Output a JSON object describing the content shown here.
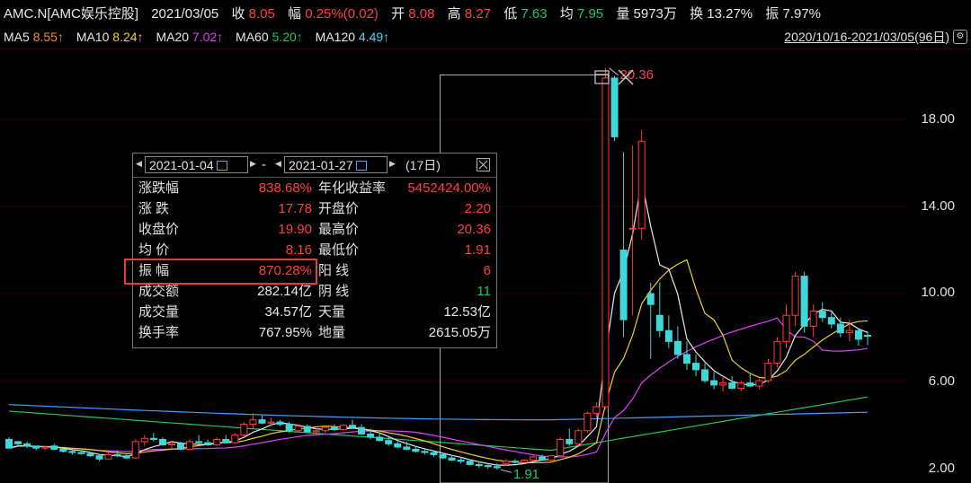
{
  "header": {
    "symbol": "AMC.N[AMC娱乐控股]",
    "date": "2021/03/05",
    "close_label": "收",
    "close_value": "8.05",
    "change_label": "幅",
    "change_value": "0.25%(0.02)",
    "open_label": "开",
    "open_value": "8.08",
    "high_label": "高",
    "high_value": "8.27",
    "low_label": "低",
    "low_value": "7.63",
    "avg_label": "均",
    "avg_value": "7.95",
    "volume_label": "量",
    "volume_value": "5973万",
    "turnover_label": "换",
    "turnover_value": "13.27%",
    "amplitude_label": "振",
    "amplitude_value": "7.97%"
  },
  "ma_bar": {
    "ma5_label": "MA5",
    "ma5_value": "8.55↑",
    "ma10_label": "MA10",
    "ma10_value": "8.24↑",
    "ma20_label": "MA20",
    "ma20_value": "7.02↑",
    "ma60_label": "MA60",
    "ma60_value": "5.20↑",
    "ma120_label": "MA120",
    "ma120_value": "4.49↑",
    "range_text": "2020/10/16-2021/03/05(96日)"
  },
  "colors": {
    "up": "#ff3b3b",
    "down": "#3fd7d7",
    "ma5": "#e8e8e8",
    "ma10": "#f0d020",
    "ma20": "#e040fb",
    "ma60": "#22c55e",
    "ma120": "#40a0ff"
  },
  "popup": {
    "start_date": "2021-01-04",
    "dash": "-",
    "end_date": "2021-01-27",
    "days": "(17日)",
    "rows": [
      {
        "k1": "涨跌幅",
        "v1": "838.68%",
        "k2": "年化收益率",
        "v2": "5452424.00%"
      },
      {
        "k1": "涨 跌",
        "v1": "17.78",
        "k2": "开盘价",
        "v2": "2.20"
      },
      {
        "k1": "收盘价",
        "v1": "19.90",
        "k2": "最高价",
        "v2": "20.36"
      },
      {
        "k1": "均 价",
        "v1": "8.16",
        "k2": "最低价",
        "v2": "1.91"
      },
      {
        "k1": "振 幅",
        "v1": "870.28%",
        "k2": "阳 线",
        "v2": "6"
      },
      {
        "k1": "成交额",
        "v1": "282.14亿",
        "k2": "阴 线",
        "v2": "11"
      },
      {
        "k1": "成交量",
        "v1": "34.57亿",
        "k2": "天量",
        "v2": "12.53亿"
      },
      {
        "k1": "换手率",
        "v1": "767.95%",
        "k2": "地量",
        "v2": "2615.05万"
      }
    ]
  },
  "chart_data": {
    "type": "candlestick",
    "y_ticks": [
      "18.00",
      "14.00",
      "10.00",
      "6.00",
      "2.00"
    ],
    "ylim": [
      1.6,
      20.6
    ],
    "high_marker": "20.36",
    "low_marker": "1.91",
    "candles": [
      [
        3.3,
        3.4,
        3.0,
        2.9
      ],
      [
        3.2,
        3.2,
        3.0,
        3.1
      ],
      [
        3.1,
        3.2,
        2.9,
        3.0
      ],
      [
        3.0,
        3.0,
        2.8,
        2.9
      ],
      [
        2.9,
        3.0,
        2.8,
        2.95
      ],
      [
        3.0,
        3.1,
        2.8,
        2.85
      ],
      [
        2.85,
        2.9,
        2.7,
        2.75
      ],
      [
        2.75,
        2.8,
        2.6,
        2.7
      ],
      [
        2.7,
        2.8,
        2.6,
        2.65
      ],
      [
        2.65,
        2.7,
        2.5,
        2.55
      ],
      [
        2.55,
        2.6,
        2.3,
        2.4
      ],
      [
        2.4,
        2.7,
        2.4,
        2.6
      ],
      [
        2.6,
        2.8,
        2.5,
        2.55
      ],
      [
        2.55,
        2.6,
        2.4,
        2.45
      ],
      [
        2.45,
        3.3,
        2.4,
        3.2
      ],
      [
        3.2,
        3.5,
        3.0,
        3.35
      ],
      [
        3.35,
        3.6,
        3.2,
        3.3
      ],
      [
        3.3,
        3.4,
        3.0,
        3.05
      ],
      [
        3.05,
        3.2,
        2.9,
        3.1
      ],
      [
        3.1,
        3.2,
        2.8,
        2.85
      ],
      [
        2.85,
        3.3,
        2.8,
        3.2
      ],
      [
        3.2,
        3.5,
        3.1,
        3.15
      ],
      [
        3.15,
        3.3,
        3.0,
        3.05
      ],
      [
        3.05,
        3.4,
        3.0,
        3.3
      ],
      [
        3.3,
        3.5,
        3.1,
        3.15
      ],
      [
        3.15,
        3.6,
        3.1,
        3.5
      ],
      [
        3.5,
        4.1,
        3.4,
        4.0
      ],
      [
        4.0,
        4.5,
        3.8,
        4.2
      ],
      [
        4.2,
        4.4,
        4.0,
        4.05
      ],
      [
        4.05,
        4.3,
        3.9,
        4.1
      ],
      [
        4.1,
        4.2,
        3.9,
        4.0
      ],
      [
        4.0,
        4.1,
        3.6,
        3.7
      ],
      [
        3.7,
        4.0,
        3.6,
        3.9
      ],
      [
        3.9,
        4.0,
        3.6,
        3.65
      ],
      [
        3.65,
        3.8,
        3.5,
        3.7
      ],
      [
        3.7,
        3.9,
        3.6,
        3.85
      ],
      [
        3.85,
        4.0,
        3.7,
        3.75
      ],
      [
        3.75,
        4.0,
        3.7,
        3.95
      ],
      [
        3.95,
        4.2,
        3.8,
        3.85
      ],
      [
        3.85,
        4.0,
        3.5,
        3.55
      ],
      [
        3.55,
        3.8,
        3.3,
        3.4
      ],
      [
        3.4,
        3.6,
        3.2,
        3.25
      ],
      [
        3.25,
        3.4,
        3.0,
        3.1
      ],
      [
        3.1,
        3.2,
        2.9,
        2.95
      ],
      [
        2.95,
        3.2,
        2.8,
        2.85
      ],
      [
        2.85,
        3.0,
        2.7,
        2.75
      ],
      [
        2.75,
        2.9,
        2.6,
        2.7
      ],
      [
        2.7,
        2.8,
        2.5,
        2.6
      ],
      [
        2.6,
        2.7,
        2.4,
        2.45
      ],
      [
        2.45,
        2.6,
        2.3,
        2.35
      ],
      [
        2.35,
        2.5,
        2.2,
        2.3
      ],
      [
        2.3,
        2.4,
        2.1,
        2.15
      ],
      [
        2.15,
        2.3,
        2.0,
        2.1
      ],
      [
        2.1,
        2.2,
        1.95,
        2.05
      ],
      [
        2.05,
        2.2,
        1.91,
        2.0
      ],
      [
        2.2,
        2.4,
        2.1,
        2.3
      ],
      [
        2.3,
        2.4,
        2.2,
        2.25
      ],
      [
        2.25,
        2.4,
        2.2,
        2.35
      ],
      [
        2.35,
        2.6,
        2.3,
        2.5
      ],
      [
        2.5,
        2.6,
        2.3,
        2.35
      ],
      [
        2.35,
        2.6,
        2.3,
        2.55
      ],
      [
        2.55,
        3.4,
        2.5,
        3.3
      ],
      [
        3.3,
        3.8,
        3.0,
        3.1
      ],
      [
        3.1,
        3.8,
        3.0,
        3.7
      ],
      [
        3.7,
        4.6,
        3.6,
        4.5
      ],
      [
        4.5,
        5.0,
        4.3,
        4.8
      ],
      [
        4.8,
        20.36,
        4.7,
        19.9
      ],
      [
        19.9,
        20.0,
        17.0,
        17.2
      ],
      [
        12.0,
        16.5,
        8.0,
        8.8
      ],
      [
        13.0,
        16.8,
        9.0,
        13.0
      ],
      [
        13.0,
        17.5,
        12.5,
        17.0
      ],
      [
        10.0,
        10.5,
        7.0,
        9.5
      ],
      [
        9.0,
        10.5,
        8.0,
        8.3
      ],
      [
        8.3,
        9.0,
        7.5,
        7.8
      ],
      [
        7.8,
        8.5,
        7.0,
        7.2
      ],
      [
        7.2,
        7.8,
        6.5,
        6.8
      ],
      [
        6.8,
        7.2,
        6.2,
        6.5
      ],
      [
        6.5,
        6.8,
        5.9,
        6.0
      ],
      [
        6.0,
        6.4,
        5.6,
        5.8
      ],
      [
        5.8,
        6.2,
        5.5,
        5.9
      ],
      [
        5.9,
        6.2,
        5.6,
        5.65
      ],
      [
        5.65,
        6.0,
        5.5,
        5.9
      ],
      [
        5.9,
        6.3,
        5.7,
        5.75
      ],
      [
        5.75,
        6.1,
        5.6,
        6.0
      ],
      [
        6.0,
        7.0,
        5.9,
        6.8
      ],
      [
        6.8,
        8.0,
        6.6,
        7.8
      ],
      [
        7.8,
        9.5,
        7.5,
        9.0
      ],
      [
        9.0,
        11.0,
        8.5,
        10.8
      ],
      [
        10.8,
        11.0,
        8.2,
        8.5
      ],
      [
        8.5,
        9.5,
        8.0,
        9.2
      ],
      [
        9.2,
        9.6,
        8.7,
        8.9
      ],
      [
        8.9,
        9.2,
        8.4,
        8.6
      ],
      [
        8.6,
        8.9,
        8.0,
        8.2
      ],
      [
        8.2,
        8.8,
        7.8,
        8.3
      ],
      [
        8.3,
        8.4,
        7.6,
        7.9
      ],
      [
        8.08,
        8.27,
        7.63,
        8.05
      ]
    ]
  }
}
